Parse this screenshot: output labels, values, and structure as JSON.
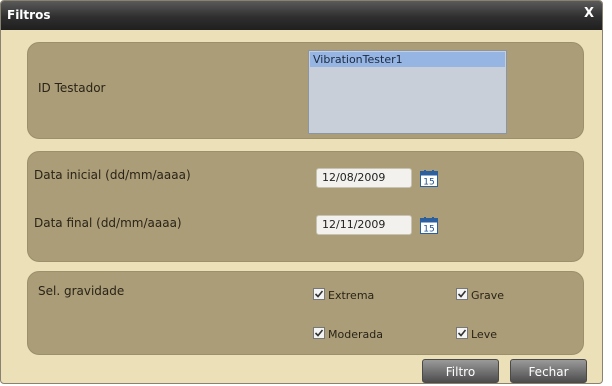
{
  "window": {
    "title": "Filtros",
    "close_label": "X"
  },
  "tester": {
    "label": "ID Testador",
    "items": [
      "VibrationTester1"
    ]
  },
  "dates": {
    "start_label": "Data inicial (dd/mm/aaaa)",
    "start_value": "12/08/2009",
    "end_label": "Data final (dd/mm/aaaa)",
    "end_value": "12/11/2009",
    "calendar_day": "15"
  },
  "severity": {
    "label": "Sel. gravidade",
    "options": [
      {
        "label": "Extrema",
        "checked": true
      },
      {
        "label": "Grave",
        "checked": true
      },
      {
        "label": "Moderada",
        "checked": true
      },
      {
        "label": "Leve",
        "checked": true
      }
    ]
  },
  "buttons": {
    "filter": "Filtro",
    "close": "Fechar"
  }
}
